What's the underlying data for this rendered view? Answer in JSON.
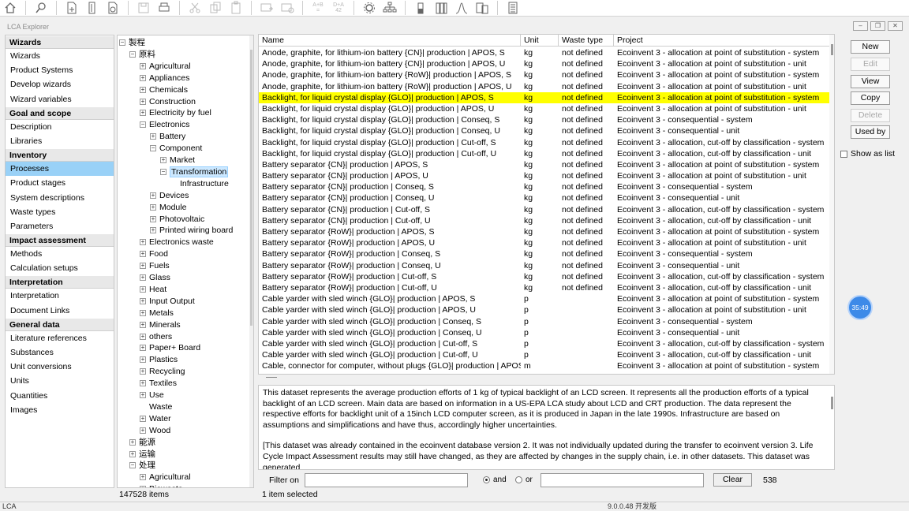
{
  "window": {
    "title": "LCA Explorer"
  },
  "toolbar": {
    "icons": [
      "home-icon",
      "search-icon",
      "new-doc-icon",
      "open-icon",
      "close-doc-icon",
      "save-icon",
      "print-icon",
      "cut-icon",
      "copy-icon",
      "paste-icon",
      "insert-icon",
      "link-icon",
      "formula-icon",
      "parameter-icon",
      "settings-icon",
      "network-icon",
      "chart-icon",
      "bar-chart-icon",
      "curve-icon",
      "compare-icon",
      "calculator-icon"
    ],
    "formula_a": "A+B",
    "formula_a2": "=",
    "formula_b": "D+A",
    "formula_b2": "42"
  },
  "sidebar": {
    "groups": [
      {
        "title": "Wizards",
        "items": [
          "Wizards",
          "Product Systems",
          "Develop wizards",
          "Wizard variables"
        ]
      },
      {
        "title": "Goal and scope",
        "items": [
          "Description",
          "Libraries"
        ]
      },
      {
        "title": "Inventory",
        "items": [
          "Processes",
          "Product stages",
          "System descriptions",
          "Waste types",
          "Parameters"
        ]
      },
      {
        "title": "Impact assessment",
        "items": [
          "Methods",
          "Calculation setups"
        ]
      },
      {
        "title": "Interpretation",
        "items": [
          "Interpretation",
          "Document Links"
        ]
      },
      {
        "title": "General data",
        "items": [
          "Literature references",
          "Substances",
          "Unit conversions",
          "Units",
          "Quantities",
          "Images"
        ]
      }
    ],
    "active": "Processes"
  },
  "tree": {
    "nodes": [
      {
        "label": "製程",
        "level": 0,
        "state": "minus"
      },
      {
        "label": "原料",
        "level": 1,
        "state": "minus"
      },
      {
        "label": "Agricultural",
        "level": 2,
        "state": "plus"
      },
      {
        "label": "Appliances",
        "level": 2,
        "state": "plus"
      },
      {
        "label": "Chemicals",
        "level": 2,
        "state": "plus"
      },
      {
        "label": "Construction",
        "level": 2,
        "state": "plus"
      },
      {
        "label": "Electricity by fuel",
        "level": 2,
        "state": "plus"
      },
      {
        "label": "Electronics",
        "level": 2,
        "state": "minus"
      },
      {
        "label": "Battery",
        "level": 3,
        "state": "plus"
      },
      {
        "label": "Component",
        "level": 3,
        "state": "minus"
      },
      {
        "label": "Market",
        "level": 4,
        "state": "plus"
      },
      {
        "label": "Transformation",
        "level": 4,
        "state": "minus",
        "selected": true
      },
      {
        "label": "Infrastructure",
        "level": 5,
        "state": "none"
      },
      {
        "label": "Devices",
        "level": 3,
        "state": "plus"
      },
      {
        "label": "Module",
        "level": 3,
        "state": "plus"
      },
      {
        "label": "Photovoltaic",
        "level": 3,
        "state": "plus"
      },
      {
        "label": "Printed wiring board",
        "level": 3,
        "state": "plus"
      },
      {
        "label": "Electronics waste",
        "level": 2,
        "state": "plus"
      },
      {
        "label": "Food",
        "level": 2,
        "state": "plus"
      },
      {
        "label": "Fuels",
        "level": 2,
        "state": "plus"
      },
      {
        "label": "Glass",
        "level": 2,
        "state": "plus"
      },
      {
        "label": "Heat",
        "level": 2,
        "state": "plus"
      },
      {
        "label": "Input Output",
        "level": 2,
        "state": "plus"
      },
      {
        "label": "Metals",
        "level": 2,
        "state": "plus"
      },
      {
        "label": "Minerals",
        "level": 2,
        "state": "plus"
      },
      {
        "label": "others",
        "level": 2,
        "state": "plus"
      },
      {
        "label": "Paper+ Board",
        "level": 2,
        "state": "plus"
      },
      {
        "label": "Plastics",
        "level": 2,
        "state": "plus"
      },
      {
        "label": "Recycling",
        "level": 2,
        "state": "plus"
      },
      {
        "label": "Textiles",
        "level": 2,
        "state": "plus"
      },
      {
        "label": "Use",
        "level": 2,
        "state": "plus"
      },
      {
        "label": "Waste",
        "level": 2,
        "state": "none"
      },
      {
        "label": "Water",
        "level": 2,
        "state": "plus"
      },
      {
        "label": "Wood",
        "level": 2,
        "state": "plus"
      },
      {
        "label": "能源",
        "level": 1,
        "state": "plus"
      },
      {
        "label": "运输",
        "level": 1,
        "state": "plus"
      },
      {
        "label": "处理",
        "level": 1,
        "state": "minus"
      },
      {
        "label": "Agricultural",
        "level": 2,
        "state": "plus"
      },
      {
        "label": "Biowaste",
        "level": 2,
        "state": "plus"
      }
    ],
    "status": "147528 items"
  },
  "table": {
    "columns": [
      "Name",
      "Unit",
      "Waste type",
      "Project"
    ],
    "rows": [
      [
        "Anode, graphite, for lithium-ion battery {CN}| production | APOS, S",
        "kg",
        "not defined",
        "Ecoinvent 3 - allocation at point of substitution - system"
      ],
      [
        "Anode, graphite, for lithium-ion battery {CN}| production | APOS, U",
        "kg",
        "not defined",
        "Ecoinvent 3 - allocation at point of substitution - unit"
      ],
      [
        "Anode, graphite, for lithium-ion battery {RoW}| production | APOS, S",
        "kg",
        "not defined",
        "Ecoinvent 3 - allocation at point of substitution - system"
      ],
      [
        "Anode, graphite, for lithium-ion battery {RoW}| production | APOS, U",
        "kg",
        "not defined",
        "Ecoinvent 3 - allocation at point of substitution - unit"
      ],
      [
        "Backlight, for liquid crystal display {GLO}| production | APOS, S",
        "kg",
        "not defined",
        "Ecoinvent 3 - allocation at point of substitution - system"
      ],
      [
        "Backlight, for liquid crystal display {GLO}| production | APOS, U",
        "kg",
        "not defined",
        "Ecoinvent 3 - allocation at point of substitution - unit"
      ],
      [
        "Backlight, for liquid crystal display {GLO}| production | Conseq, S",
        "kg",
        "not defined",
        "Ecoinvent 3 - consequential - system"
      ],
      [
        "Backlight, for liquid crystal display {GLO}| production | Conseq, U",
        "kg",
        "not defined",
        "Ecoinvent 3 - consequential - unit"
      ],
      [
        "Backlight, for liquid crystal display {GLO}| production | Cut-off, S",
        "kg",
        "not defined",
        "Ecoinvent 3 - allocation, cut-off by classification - system"
      ],
      [
        "Backlight, for liquid crystal display {GLO}| production | Cut-off, U",
        "kg",
        "not defined",
        "Ecoinvent 3 - allocation, cut-off by classification - unit"
      ],
      [
        "Battery separator {CN}| production | APOS, S",
        "kg",
        "not defined",
        "Ecoinvent 3 - allocation at point of substitution - system"
      ],
      [
        "Battery separator {CN}| production | APOS, U",
        "kg",
        "not defined",
        "Ecoinvent 3 - allocation at point of substitution - unit"
      ],
      [
        "Battery separator {CN}| production | Conseq, S",
        "kg",
        "not defined",
        "Ecoinvent 3 - consequential - system"
      ],
      [
        "Battery separator {CN}| production | Conseq, U",
        "kg",
        "not defined",
        "Ecoinvent 3 - consequential - unit"
      ],
      [
        "Battery separator {CN}| production | Cut-off, S",
        "kg",
        "not defined",
        "Ecoinvent 3 - allocation, cut-off by classification - system"
      ],
      [
        "Battery separator {CN}| production | Cut-off, U",
        "kg",
        "not defined",
        "Ecoinvent 3 - allocation, cut-off by classification - unit"
      ],
      [
        "Battery separator {RoW}| production | APOS, S",
        "kg",
        "not defined",
        "Ecoinvent 3 - allocation at point of substitution - system"
      ],
      [
        "Battery separator {RoW}| production | APOS, U",
        "kg",
        "not defined",
        "Ecoinvent 3 - allocation at point of substitution - unit"
      ],
      [
        "Battery separator {RoW}| production | Conseq, S",
        "kg",
        "not defined",
        "Ecoinvent 3 - consequential - system"
      ],
      [
        "Battery separator {RoW}| production | Conseq, U",
        "kg",
        "not defined",
        "Ecoinvent 3 - consequential - unit"
      ],
      [
        "Battery separator {RoW}| production | Cut-off, S",
        "kg",
        "not defined",
        "Ecoinvent 3 - allocation, cut-off by classification - system"
      ],
      [
        "Battery separator {RoW}| production | Cut-off, U",
        "kg",
        "not defined",
        "Ecoinvent 3 - allocation, cut-off by classification - unit"
      ],
      [
        "Cable yarder with sled winch {GLO}| production | APOS, S",
        "p",
        "",
        "Ecoinvent 3 - allocation at point of substitution - system"
      ],
      [
        "Cable yarder with sled winch {GLO}| production | APOS, U",
        "p",
        "",
        "Ecoinvent 3 - allocation at point of substitution - unit"
      ],
      [
        "Cable yarder with sled winch {GLO}| production | Conseq, S",
        "p",
        "",
        "Ecoinvent 3 - consequential - system"
      ],
      [
        "Cable yarder with sled winch {GLO}| production | Conseq, U",
        "p",
        "",
        "Ecoinvent 3 - consequential - unit"
      ],
      [
        "Cable yarder with sled winch {GLO}| production | Cut-off, S",
        "p",
        "",
        "Ecoinvent 3 - allocation, cut-off by classification - system"
      ],
      [
        "Cable yarder with sled winch {GLO}| production | Cut-off, U",
        "p",
        "",
        "Ecoinvent 3 - allocation, cut-off by classification - unit"
      ],
      [
        "Cable, connector for computer, without plugs {GLO}| production | APOS, S",
        "m",
        "",
        "Ecoinvent 3 - allocation at point of substitution - system"
      ]
    ],
    "highlight_row": 4,
    "highlight_color": "#ffff00",
    "status": "1 item selected"
  },
  "description": {
    "paragraphs": [
      "This dataset represents the average production efforts of 1 kg of typical backlight of an LCD screen.  It represents all the production efforts of a typical backlight of an LCD screen. Main data are based on information in a US-EPA LCA study about LCD and CRT production. The data represent the respective efforts for backlight unit of a 15inch LCD computer screen, as it is produced in Japan in the late 1990s. Infrastructure are based on assumptions and simplifications and have thus, accordingly higher uncertainties.",
      "[This dataset was already contained in the ecoinvent database version 2. It was not individually updated during the transfer to ecoinvent version 3. Life Cycle Impact Assessment results may still have changed, as they are affected by changes in the supply chain, i.e. in other datasets. This dataset was generated"
    ]
  },
  "filter": {
    "label": "Filter on",
    "value1": "",
    "radio_and": "and",
    "radio_or": "or",
    "selected": "and",
    "value2": "",
    "clear_label": "Clear",
    "count": "538"
  },
  "actions": {
    "new": "New",
    "edit": "Edit",
    "view": "View",
    "copy": "Copy",
    "delete": "Delete",
    "used_by": "Used by",
    "show_as_list": "Show as list"
  },
  "timer": "35:49",
  "bottom": {
    "left": "LCA",
    "version": "9.0.0.48 开发版"
  },
  "colors": {
    "selection": "#99d1f7",
    "highlight": "#ffff00",
    "timer": "#3d8ae8"
  }
}
